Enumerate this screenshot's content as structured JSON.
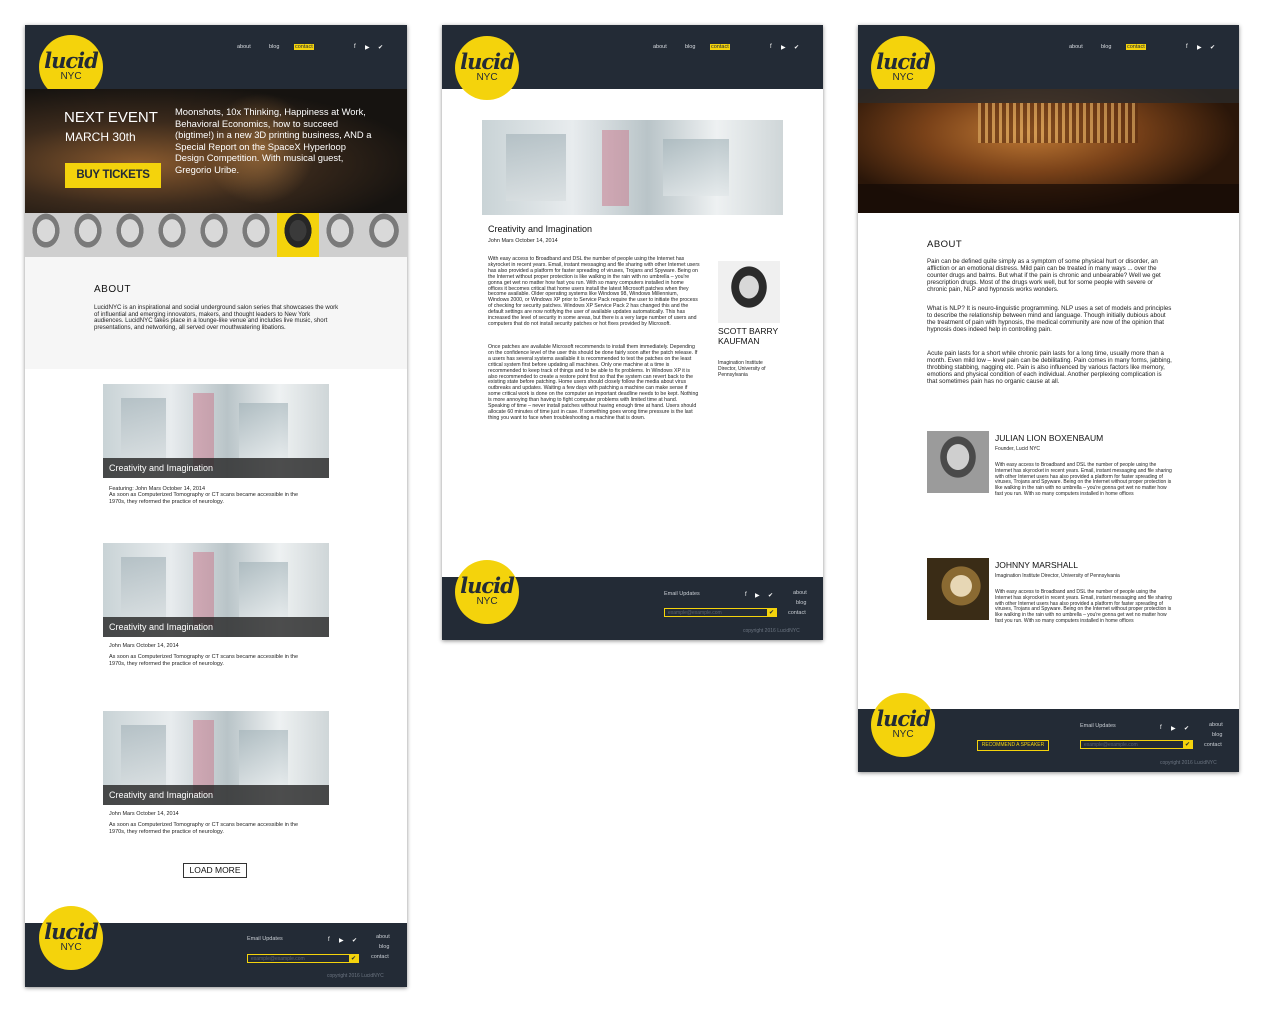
{
  "nav": {
    "about": "about",
    "blog": "blog",
    "contact": "contact"
  },
  "social": {
    "facebook": "f",
    "youtube": "▶",
    "twitter": "✔"
  },
  "logo": {
    "word": "lucid",
    "city": "NYC"
  },
  "home": {
    "event": {
      "label": "NEXT EVENT",
      "date": "MARCH 30th",
      "cta": "BUY TICKETS",
      "description": "Moonshots, 10x Thinking, Happiness at Work, Behavioral Economics, how to succeed (bigtime!) in a new 3D printing business, AND a Special Report on the SpaceX Hyperloop Design Competition. With musical guest, Gregorio Uribe."
    },
    "about": {
      "heading": "ABOUT",
      "body": "LucidNYC is an inspirational and social underground salon series that showcases the work of influential and emerging innovators, makers, and thought leaders to New York audiences. LucidNYC takes place in a lounge-like venue and includes live music, short presentations, and networking, all served over mouthwatering libations."
    },
    "posts": [
      {
        "title": "Creativity and Imagination",
        "meta": "Featuring: John Mars  October 14, 2014",
        "excerpt": "As soon as Computerized Tomography or CT scans became accessible in the 1970s, they reformed the practice of neurology."
      },
      {
        "title": "Creativity and Imagination",
        "meta": "John Mars  October 14, 2014",
        "excerpt": "As soon as Computerized Tomography or CT scans became accessible in the 1970s, they reformed the practice of neurology."
      },
      {
        "title": "Creativity and Imagination",
        "meta": "John Mars  October 14, 2014",
        "excerpt": "As soon as Computerized Tomography or CT scans became accessible in the 1970s, they reformed the practice of neurology."
      }
    ],
    "load_more": "LOAD MORE"
  },
  "article": {
    "title": "Creativity and Imagination",
    "meta": "John Mars  October 14, 2014",
    "para1": "With easy access to Broadband and DSL the number of people using the Internet has skyrocket in recent years. Email, instant messaging and file sharing with other Internet users has also provided a platform for faster spreading of viruses, Trojans and Spyware. Being on the Internet without proper protection is like walking in the rain with no umbrella – you're gonna get wet no matter how fast you run. With so many computers installed in home offices it becomes critical that home users install the latest Microsoft patches when they become available. Older operating systems like Windows 98, Windows Millennium, Windows 2000, or Windows XP prior to Service Pack require the user to initiate the process of checking for security patches. Windows XP Service Pack 2 has changed this and the default settings are now notifying the user of available updates automatically. This has increased the level of security in some areas, but there is a very large number of users and computers that do not install security patches or hot fixes provided by Microsoft.",
    "para2": "Once patches are available Microsoft recommends to install them immediately. Depending on the confidence level of the user this should be done fairly soon after the patch release. If a users has several systems available it is recommended to test the patches on the least critical system first before updating all machines. Only one machine at a time is recommended to keep track of things and to be able to fix problems. In Windows XP it is also recommended to create a restore point first so that the system can revert back to the existing state before patching. Home users should closely follow the media about virus outbreaks and updates. Waiting a few days with patching a machine can make sense if some critical work is done on the computer an important deadline needs to be kept. Nothing is more annoying than having to fight computer problems with limited time at hand. Speaking of time – never install patches without having enough time at hand. Users should allocate 60 minutes of time just in case. If something goes wrong time pressure is the last thing you want to face when troubleshooting a machine that is down.",
    "speaker_name": "SCOTT BARRY KAUFMAN",
    "speaker_role": "Imagination Institute Director, University of Pennsylvania"
  },
  "aboutpage": {
    "heading": "ABOUT",
    "p1": "Pain can be defined quite simply as a symptom of some physical hurt or disorder, an affliction or an emotional distress. Mild pain can be treated in many ways ... over the counter drugs and balms. But what if the pain is chronic and unbearable? Well we get prescription drugs. Most of the drugs work well, but for some people with severe or chronic pain, NLP and hypnosis works wonders.",
    "p2": "What is NLP? It is neuro-linguistic programming. NLP uses a set of models and principles to describe the relationship between mind and language. Though initially dubious about the treatment of pain with hypnosis, the medical community are now of the opinion that hypnosis does indeed help in controlling pain.",
    "p3": "Acute pain lasts for a short while chronic pain lasts for a long time, usually more than a month. Even mild low – level pain can be debilitating. Pain comes in many forms, jabbing, throbbing stabbing, nagging etc. Pain is also influenced by various factors like memory, emotions and physical condition of each individual. Another perplexing complication is that sometimes pain has no organic cause at all.",
    "people": [
      {
        "name": "JULIAN LION BOXENBAUM",
        "role": "Founder, Lucid NYC",
        "bio": "With easy access to Broadband and DSL the number of people using the Internet has skyrocket in recent years. Email, instant messaging and file sharing with other Internet users has also provided a platform for faster spreading of viruses, Trojans and Spyware. Being on the Internet without proper protection is like walking in the rain with no umbrella – you're gonna get wet no matter how fast you run. With so many computers installed in home offices"
      },
      {
        "name": "JOHNNY MARSHALL",
        "role": "Imagination Institute Director, University of Pennsylvania",
        "bio": "With easy access to Broadband and DSL the number of people using the Internet has skyrocket in recent years. Email, instant messaging and file sharing with other Internet users has also provided a platform for faster spreading of viruses, Trojans and Spyware. Being on the Internet without proper protection is like walking in the rain with no umbrella – you're gonna get wet no matter how fast you run. With so many computers installed in home offices"
      }
    ],
    "recommend": "RECOMMEND A SPEAKER"
  },
  "footer": {
    "email_label": "Email Updates",
    "email_placeholder": "example@example.com",
    "links": [
      "about",
      "blog",
      "contact"
    ],
    "copyright": "copyright 2016 LucidNYC"
  },
  "colors": {
    "navy": "#232b36",
    "yellow": "#f4d30c"
  }
}
